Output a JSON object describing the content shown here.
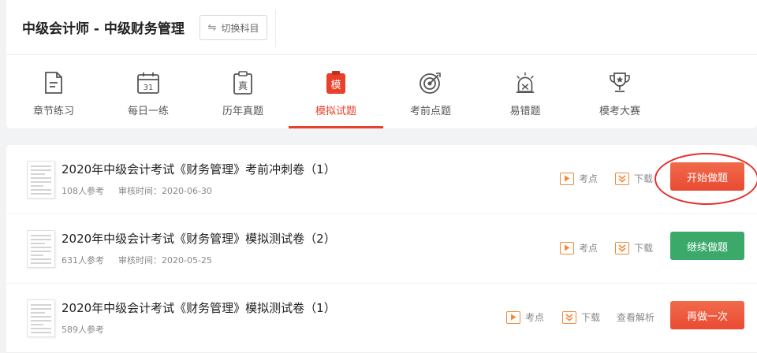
{
  "header": {
    "title": "中级会计师 - 中级财务管理",
    "switch_label": "切换科目",
    "switch_icon": "swap-arrows-icon"
  },
  "nav": {
    "active_color": "#e8402a",
    "items": [
      {
        "label": "章节练习",
        "icon": "document-icon"
      },
      {
        "label": "每日一练",
        "icon": "calendar-icon",
        "icon_text": "31"
      },
      {
        "label": "历年真题",
        "icon": "clipboard-icon",
        "icon_text": "真"
      },
      {
        "label": "模拟试题",
        "icon": "mock-exam-icon",
        "icon_text": "模",
        "active": true
      },
      {
        "label": "考前点题",
        "icon": "target-icon"
      },
      {
        "label": "易错题",
        "icon": "alarm-icon"
      },
      {
        "label": "模考大赛",
        "icon": "trophy-icon"
      }
    ]
  },
  "papers": [
    {
      "title": "2020年中级会计考试《财务管理》考前冲刺卷（1）",
      "participants": "108人参考",
      "review_time": "审核时间：2020-06-30",
      "kaodian_label": "考点",
      "download_label": "下载",
      "button_label": "开始做题",
      "button_color": "#e94b33"
    },
    {
      "title": "2020年中级会计考试《财务管理》模拟测试卷（2）",
      "participants": "631人参考",
      "review_time": "审核时间：2020-05-25",
      "kaodian_label": "考点",
      "download_label": "下载",
      "button_label": "继续做题",
      "button_color": "#3aa96a"
    },
    {
      "title": "2020年中级会计考试《财务管理》模拟测试卷（1）",
      "participants": "589人参考",
      "kaodian_label": "考点",
      "download_label": "下载",
      "review_label": "查看解析",
      "button_label": "再做一次",
      "button_color": "#e94b33"
    }
  ]
}
